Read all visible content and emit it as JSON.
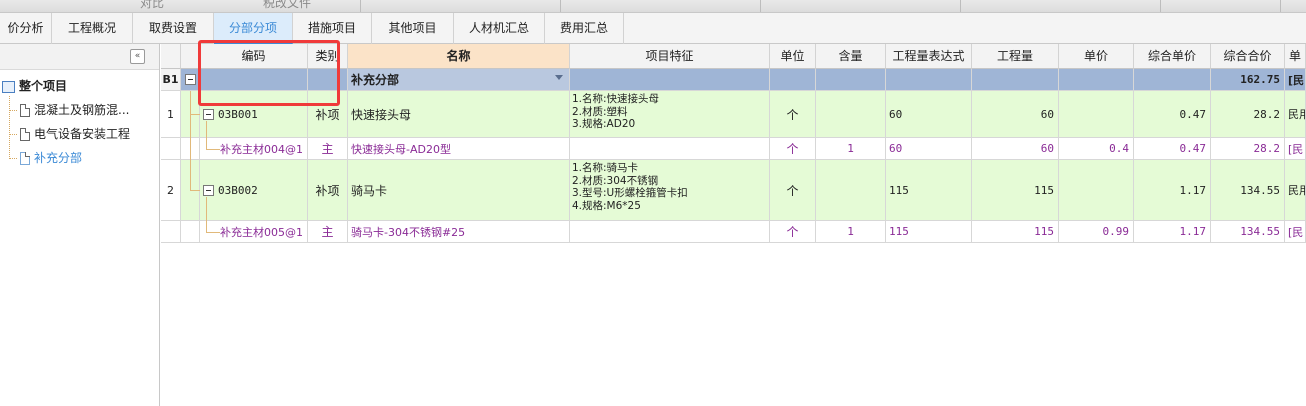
{
  "top_strip": [
    "对比",
    "税改文件"
  ],
  "tabs": [
    {
      "label": "价分析",
      "active": false
    },
    {
      "label": "工程概况",
      "active": false
    },
    {
      "label": "取费设置",
      "active": false
    },
    {
      "label": "分部分项",
      "active": true
    },
    {
      "label": "措施项目",
      "active": false
    },
    {
      "label": "其他项目",
      "active": false
    },
    {
      "label": "人材机汇总",
      "active": false
    },
    {
      "label": "费用汇总",
      "active": false
    }
  ],
  "sidebar": {
    "collapse_glyph": "«",
    "root": "整个项目",
    "items": [
      "混凝土及钢筋混...",
      "电气设备安装工程",
      "补充分部"
    ],
    "selected_color": "#3b8ad6"
  },
  "columns": [
    "编码",
    "类别",
    "名称",
    "项目特征",
    "单位",
    "含量",
    "工程量表达式",
    "工程量",
    "单价",
    "综合单价",
    "综合合价",
    "单"
  ],
  "rows": [
    {
      "kind": "b1",
      "num": "B1",
      "code": "",
      "category": "",
      "name": "补充分部",
      "feature": "",
      "unit": "",
      "content": "",
      "expr": "",
      "qty": "",
      "price": "",
      "unit_total": "",
      "total": "162.75",
      "extra": "[民"
    },
    {
      "kind": "item",
      "num": "1",
      "code": "03B001",
      "category": "补项",
      "name": "快速接头母",
      "feature": "1.名称:快速接头母\n2.材质:塑料\n3.规格:AD20",
      "unit": "个",
      "content": "",
      "expr": "60",
      "qty": "60",
      "price": "",
      "unit_total": "0.47",
      "total": "28.2",
      "extra": "民用"
    },
    {
      "kind": "sub",
      "num": "",
      "code": "补充主材004@1",
      "category": "主",
      "name": "快速接头母-AD20型",
      "feature": "",
      "unit": "个",
      "content": "1",
      "expr": "60",
      "qty": "60",
      "price": "0.4",
      "unit_total": "0.47",
      "total": "28.2",
      "extra": "[民"
    },
    {
      "kind": "item",
      "num": "2",
      "code": "03B002",
      "category": "补项",
      "name": "骑马卡",
      "feature": "1.名称:骑马卡\n2.材质:304不锈钢\n3.型号:U形螺栓箍管卡扣\n4.规格:M6*25",
      "unit": "个",
      "content": "",
      "expr": "115",
      "qty": "115",
      "price": "",
      "unit_total": "1.17",
      "total": "134.55",
      "extra": "民用"
    },
    {
      "kind": "sub",
      "num": "",
      "code": "补充主材005@1",
      "category": "主",
      "name": "骑马卡-304不锈钢#25",
      "feature": "",
      "unit": "个",
      "content": "1",
      "expr": "115",
      "qty": "115",
      "price": "0.99",
      "unit_total": "1.17",
      "total": "134.55",
      "extra": "[民"
    }
  ],
  "colors": {
    "header_name": "#fbe3c8",
    "b1_row": "#9fb5d6",
    "item_row": "#e5fbd6",
    "sub_text": "#8a2b96",
    "highlight": "#f03a3a"
  }
}
